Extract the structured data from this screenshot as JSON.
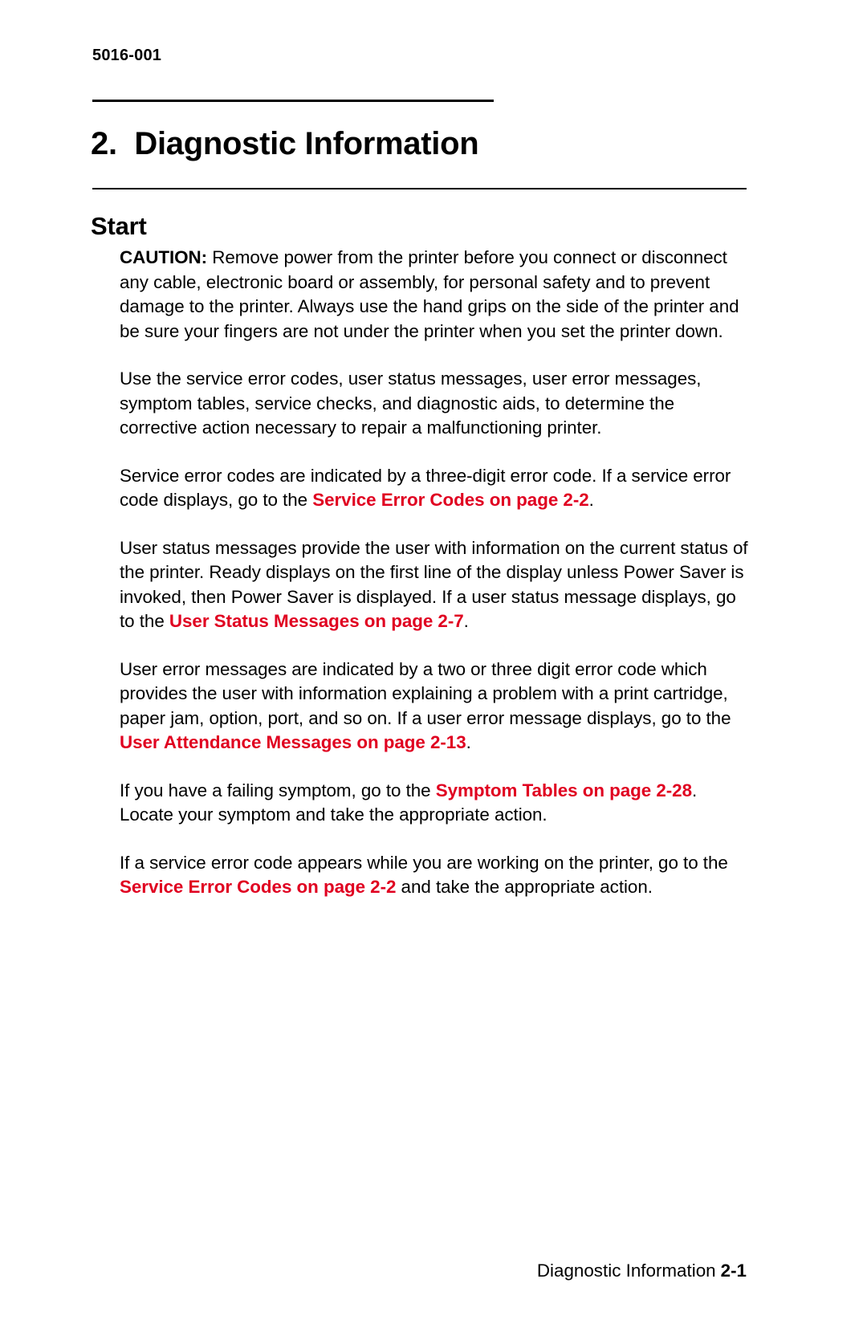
{
  "document": {
    "number": "5016-001",
    "chapter_title": "2.  Diagnostic Information",
    "section_title": "Start"
  },
  "paragraphs": {
    "caution": {
      "label": "CAUTION:",
      "text": "  Remove power from the printer before you connect or disconnect any cable, electronic board or assembly, for personal safety and to prevent damage to the printer. Always use the hand grips on the side of the printer and be sure your fingers are not under the printer when you set the printer down."
    },
    "overview": "Use the service error codes, user status messages, user error messages, symptom tables, service checks, and diagnostic aids, to determine the corrective action necessary to repair a malfunctioning printer.",
    "service_error": {
      "lead": "Service error codes are indicated by a three-digit error code. If a service error code displays, go to the ",
      "ref": "Service Error Codes  on page 2-2",
      "tail": "."
    },
    "user_status": {
      "lead": "User status messages provide the user with information on the current status of the printer.  Ready  displays on the first line of the display unless Power Saver is invoked, then Power Saver is displayed. If a user status message displays, go to the ",
      "ref": "User Status Messages  on page 2-7",
      "tail": "."
    },
    "user_error": {
      "lead": "User error messages are indicated by a two or three digit error code which provides the user with information explaining a problem with a print cartridge, paper jam, option, port, and so on. If a user error message displays, go to the ",
      "ref": "User Attendance Messages  on page 2-13",
      "tail": "."
    },
    "symptom": {
      "lead": "If you have a failing symptom, go to the ",
      "ref": "Symptom Tables  on page 2-28",
      "tail": ". Locate your symptom and take the appropriate action."
    },
    "working": {
      "lead": "If a service error code appears while you are working on the printer, go to the ",
      "ref": "Service Error Codes  on page 2-2",
      "tail": " and take the appropriate action."
    }
  },
  "footer": {
    "label": "Diagnostic Information",
    "page": "2-1"
  },
  "colors": {
    "reference_link": "#e00020",
    "text": "#000000",
    "background": "#ffffff"
  }
}
